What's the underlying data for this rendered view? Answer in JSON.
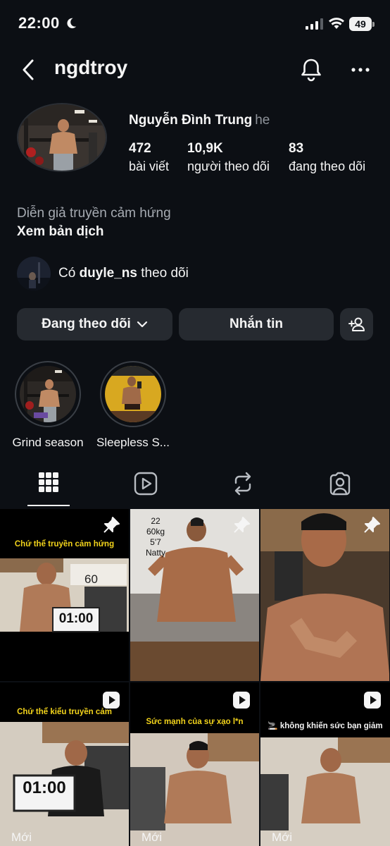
{
  "status_bar": {
    "time": "22:00",
    "battery": "49"
  },
  "header": {
    "username": "ngdtroy"
  },
  "profile": {
    "full_name": "Nguyễn Đình Trung",
    "pronoun": "he",
    "stats": [
      {
        "value": "472",
        "label": "bài viết"
      },
      {
        "value": "10,9K",
        "label": "người theo dõi"
      },
      {
        "value": "83",
        "label": "đang theo dõi"
      }
    ],
    "category": "Diễn giả truyền cảm hứng",
    "see_translation": "Xem bản dịch",
    "mutual": {
      "prefix": "Có",
      "name": "duyle_ns",
      "suffix": "theo dõi"
    }
  },
  "actions": {
    "following": "Đang theo dõi",
    "message": "Nhắn tin"
  },
  "highlights": [
    {
      "label": "Grind season"
    },
    {
      "label": "Sleepless S..."
    }
  ],
  "tabs": [
    "grid-icon",
    "reels-icon",
    "reposts-icon",
    "tagged-icon"
  ],
  "posts": [
    {
      "caption": "Chứ thể truyền cảm hứng",
      "timer": "01:00",
      "overlay": "60",
      "pinned": true
    },
    {
      "overlay_lines": [
        "22",
        "60kg",
        "5'7",
        "Natty"
      ],
      "pinned": true
    },
    {
      "pinned": true
    },
    {
      "caption": "Chứ thể kiểu truyền cảm",
      "timer": "01:00",
      "label": "Mới",
      "reel": true
    },
    {
      "caption": "Sức mạnh của sự xạo l*n",
      "label": "Mới",
      "reel": true
    },
    {
      "caption": "🚬 không khiến sức bạn giảm",
      "label": "Mới",
      "reel": true
    }
  ]
}
